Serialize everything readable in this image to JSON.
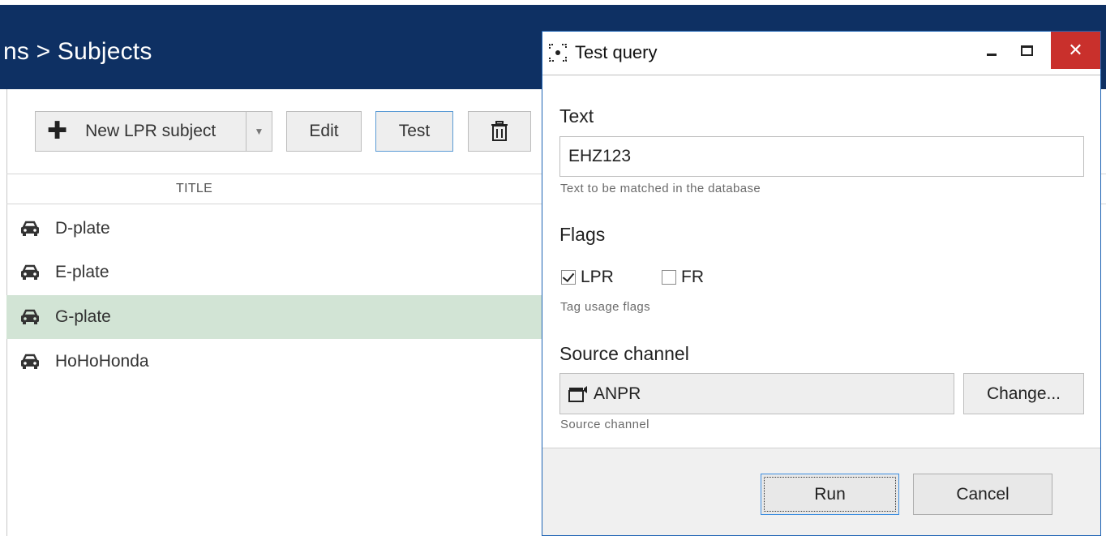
{
  "app": {
    "breadcrumb": "ns > Subjects"
  },
  "toolbar": {
    "new_label": "New LPR subject",
    "edit_label": "Edit",
    "test_label": "Test"
  },
  "table": {
    "column_title": "TITLE",
    "rows": [
      {
        "title": "D-plate",
        "selected": false
      },
      {
        "title": "E-plate",
        "selected": false
      },
      {
        "title": "G-plate",
        "selected": true
      },
      {
        "title": "HoHoHonda",
        "selected": false
      }
    ]
  },
  "dialog": {
    "title": "Test query",
    "text_section": {
      "label": "Text",
      "value": "EHZ123",
      "help": "Text to be matched in the database"
    },
    "flags_section": {
      "label": "Flags",
      "lpr_label": "LPR",
      "lpr_checked": true,
      "fr_label": "FR",
      "fr_checked": false,
      "help": "Tag usage flags"
    },
    "source_section": {
      "label": "Source channel",
      "channel": "ANPR",
      "change_label": "Change...",
      "help": "Source channel"
    },
    "run_label": "Run",
    "cancel_label": "Cancel"
  },
  "colors": {
    "header_bg": "#0e3063",
    "selected_row": "#d2e4d5",
    "close_button": "#c9302c",
    "focus_border": "#3d8ee0"
  }
}
